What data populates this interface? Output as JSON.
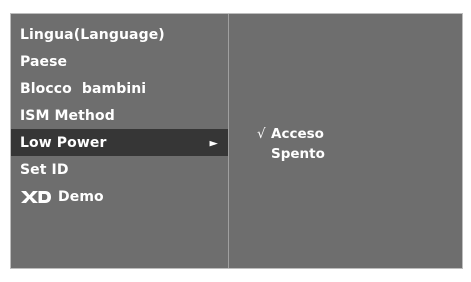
{
  "menu": {
    "items": [
      {
        "label": "Lingua(Language)"
      },
      {
        "label": "Paese"
      },
      {
        "label": "Blocco  bambini"
      },
      {
        "label": "ISM Method"
      },
      {
        "label": "Low Power",
        "arrow": "►"
      },
      {
        "label": "Set ID"
      },
      {
        "label": "Demo",
        "logo": "XD"
      }
    ]
  },
  "submenu": {
    "options": [
      {
        "label": "Acceso",
        "check": "√"
      },
      {
        "label": "Spento",
        "check": ""
      }
    ]
  }
}
